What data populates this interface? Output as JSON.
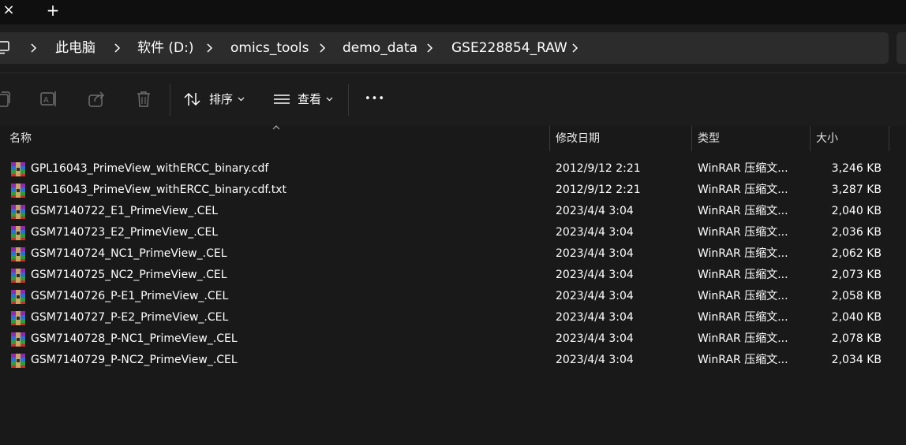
{
  "tabbar": {
    "close_glyph": "×",
    "new_tab_glyph": "+"
  },
  "breadcrumb": {
    "items": [
      "此电脑",
      "软件 (D:)",
      "omics_tools",
      "demo_data",
      "GSE228854_RAW"
    ]
  },
  "toolbar": {
    "sort_label": "排序",
    "view_label": "查看",
    "more_label": "•••"
  },
  "columns": {
    "name": "名称",
    "date": "修改日期",
    "type": "类型",
    "size": "大小"
  },
  "files": [
    {
      "name": "GPL16043_PrimeView_withERCC_binary.cdf",
      "date": "2012/9/12 2:21",
      "type": "WinRAR 压缩文...",
      "size": "3,246 KB"
    },
    {
      "name": "GPL16043_PrimeView_withERCC_binary.cdf.txt",
      "date": "2012/9/12 2:21",
      "type": "WinRAR 压缩文...",
      "size": "3,287 KB"
    },
    {
      "name": "GSM7140722_E1_PrimeView_.CEL",
      "date": "2023/4/4 3:04",
      "type": "WinRAR 压缩文...",
      "size": "2,040 KB"
    },
    {
      "name": "GSM7140723_E2_PrimeView_.CEL",
      "date": "2023/4/4 3:04",
      "type": "WinRAR 压缩文...",
      "size": "2,036 KB"
    },
    {
      "name": "GSM7140724_NC1_PrimeView_.CEL",
      "date": "2023/4/4 3:04",
      "type": "WinRAR 压缩文...",
      "size": "2,062 KB"
    },
    {
      "name": "GSM7140725_NC2_PrimeView_.CEL",
      "date": "2023/4/4 3:04",
      "type": "WinRAR 压缩文...",
      "size": "2,073 KB"
    },
    {
      "name": "GSM7140726_P-E1_PrimeView_.CEL",
      "date": "2023/4/4 3:04",
      "type": "WinRAR 压缩文...",
      "size": "2,058 KB"
    },
    {
      "name": "GSM7140727_P-E2_PrimeView_.CEL",
      "date": "2023/4/4 3:04",
      "type": "WinRAR 压缩文...",
      "size": "2,040 KB"
    },
    {
      "name": "GSM7140728_P-NC1_PrimeView_.CEL",
      "date": "2023/4/4 3:04",
      "type": "WinRAR 压缩文...",
      "size": "2,078 KB"
    },
    {
      "name": "GSM7140729_P-NC2_PrimeView_.CEL",
      "date": "2023/4/4 3:04",
      "type": "WinRAR 压缩文...",
      "size": "2,034 KB"
    }
  ],
  "icons": {
    "file_icon": "winrar-archive-icon",
    "toolbar": [
      "copy-icon",
      "rename-icon",
      "share-icon",
      "delete-icon",
      "sort-icon",
      "view-icon"
    ]
  }
}
